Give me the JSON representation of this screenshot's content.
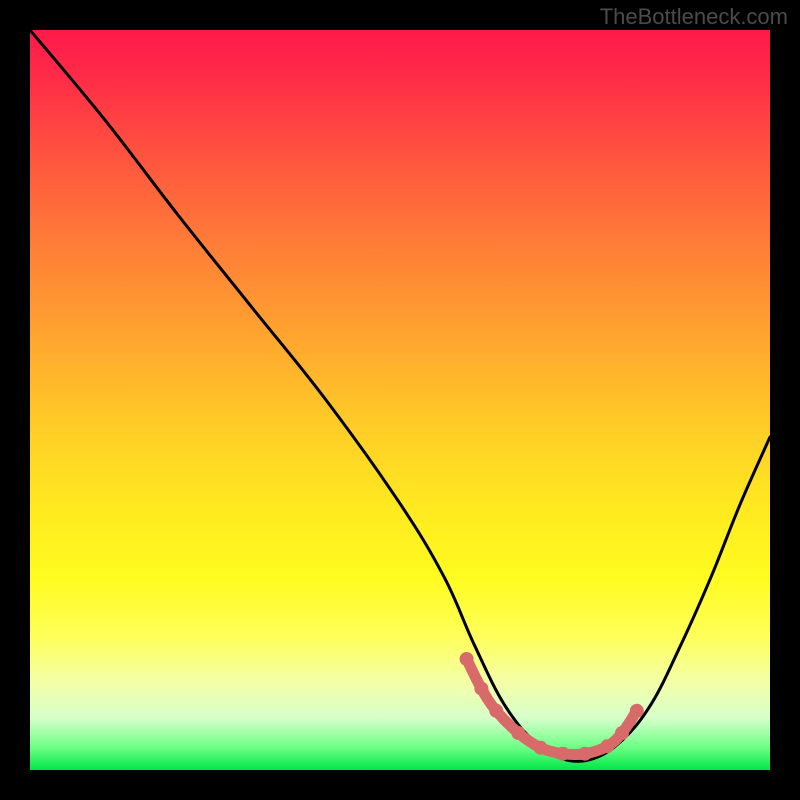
{
  "watermark": "TheBottleneck.com",
  "chart_data": {
    "type": "line",
    "title": "",
    "xlabel": "",
    "ylabel": "",
    "xlim": [
      0,
      100
    ],
    "ylim": [
      0,
      100
    ],
    "curve": {
      "name": "performance-curve",
      "x": [
        0,
        10,
        20,
        30,
        40,
        50,
        56,
        60,
        64,
        68,
        72,
        76,
        80,
        84,
        88,
        92,
        96,
        100
      ],
      "y": [
        100,
        88,
        75,
        62.5,
        50,
        36,
        26,
        17,
        9,
        4,
        1.5,
        1.5,
        4,
        9,
        17,
        26,
        36,
        45
      ]
    },
    "highlight": {
      "name": "optimal-zone",
      "x": [
        59,
        61,
        63,
        66,
        69,
        72,
        75,
        78,
        80,
        82
      ],
      "y": [
        15,
        11,
        8,
        5,
        3,
        2.2,
        2.2,
        3.2,
        5,
        8
      ]
    },
    "colors": {
      "gradient_top": "#ff1a4a",
      "gradient_mid": "#ffe820",
      "gradient_bottom": "#00e648",
      "curve": "#000000",
      "highlight": "#d86a6a"
    }
  }
}
